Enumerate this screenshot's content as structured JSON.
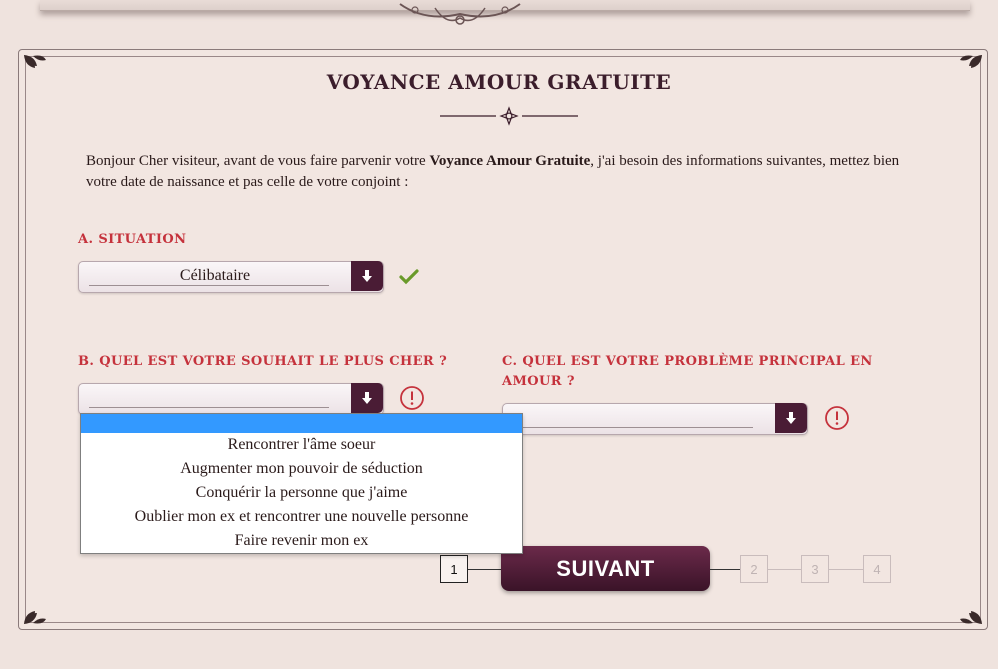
{
  "header": {
    "title": "VOYANCE AMOUR GRATUITE"
  },
  "intro": {
    "part1": "Bonjour Cher visiteur, avant de vous faire parvenir votre ",
    "bold": "Voyance Amour Gratuite",
    "part2": ", j'ai besoin des informations suivantes, mettez bien votre date de naissance et pas celle de votre conjoint :"
  },
  "section_a": {
    "label": "A. SITUATION",
    "selected": "Célibataire",
    "status": "check-icon"
  },
  "section_b": {
    "label": "B. QUEL EST VOTRE SOUHAIT LE PLUS CHER ?",
    "selected": "",
    "status": "warning-icon",
    "options": [
      "Rencontrer l'âme soeur",
      "Augmenter mon pouvoir de séduction",
      "Conquérir la personne que j'aime",
      "Oublier mon ex et rencontrer une nouvelle personne",
      "Faire revenir mon ex"
    ]
  },
  "section_c": {
    "label_line1": "C. QUEL EST VOTRE PROBLÈME PRINCIPAL EN",
    "label_line2": "AMOUR ?",
    "selected": "",
    "status": "warning-icon"
  },
  "stepper": {
    "steps": [
      "1",
      "2",
      "3",
      "4"
    ],
    "current": "1",
    "next_label": "SUIVANT"
  },
  "colors": {
    "accent": "#4a1c35",
    "label_red": "#c5323c",
    "highlight_blue": "#3399ff",
    "check_green": "#6a9a2a"
  }
}
